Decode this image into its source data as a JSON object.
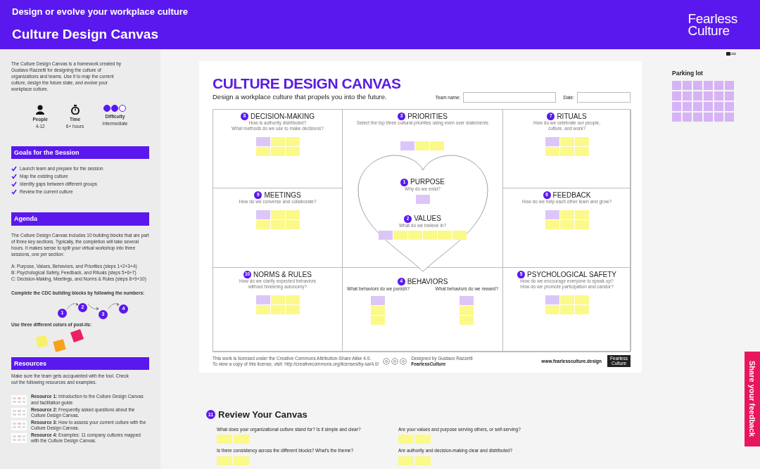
{
  "header": {
    "subtitle": "Design or evolve your workplace culture",
    "title": "Culture Design Canvas",
    "logo_lines": [
      "Fearless",
      "Culture"
    ]
  },
  "sidebar": {
    "intro": "The Culture Design Canvas is a framework created by Gustavo Razzetti for designing the culture of organizations and teams. Use it to map the current culture, design the future state, and evolve your workplace culture.",
    "stats": [
      {
        "kind": "people",
        "label": "People",
        "value": "4-12"
      },
      {
        "kind": "time",
        "label": "Time",
        "value": "6+ hours"
      },
      {
        "kind": "difficulty",
        "label": "Difficulty",
        "value": "Intermediate",
        "stars": 2
      }
    ],
    "goals": {
      "heading": "Goals for the Session",
      "items": [
        "Launch team and prepare for the session",
        "Map the existing culture",
        "Identify gaps between different groups",
        "Review the current culture"
      ]
    },
    "agenda": {
      "heading": "Agenda",
      "paragraph": "The Culture Design Canvas includes 10 building blocks that are part of three key sections. Typically, the completion will take several hours. It makes sense to split your virtual workshop into three sessions, one per section:",
      "sections": [
        "A: Purpose, Values, Behaviors, and Priorities (steps 1+2+3+4)",
        "B: Psychological Safety, Feedback, and Rituals (steps 5+6+7)",
        "C: Decision-Making, Meetings, and Norms & Rules (steps 8+9+10)"
      ],
      "steps_caption": "Complete the CDC building blocks by following the numbers:",
      "steps": [
        "1",
        "2",
        "3",
        "4"
      ],
      "postits_caption": "Use three different colors of post-its:",
      "postits": [
        {
          "color": "#f8f06a"
        },
        {
          "color": "#f7a21b"
        },
        {
          "color": "#ec1f5f"
        }
      ]
    },
    "resources": {
      "heading": "Resources",
      "intro": "Make sure the team gets accquainted with the tool. Check out the following resources and examples.",
      "items": [
        "**Resource 1:** Introduction to the Culture Design Canvas and facilitation guide",
        "**Resource 2:** Frequently asked questions about the Culture Design Canvas.",
        "**Resource 3:** How to assess your current culture with the Culture Design Canvas.",
        "**Resource 4:** Examples: 11 company cultures mapped with the Culture Design Canvas."
      ]
    }
  },
  "canvas": {
    "title": "CULTURE DESIGN CANVAS",
    "subtitle": "Design a workplace culture that propels you into the future.",
    "fields": [
      {
        "label": "Team name:"
      },
      {
        "label": "Date:"
      }
    ],
    "blocks": [
      {
        "kind": "grid",
        "number": "8",
        "title": "DECISION-MAKING",
        "questions": [
          "How is authority distributed?",
          "What methods do we use to make decisions?"
        ],
        "notes": [
          {
            "color": "#dcc6f8"
          },
          {
            "color": "#fbf98a"
          },
          {
            "color": "#fbf98a"
          },
          {
            "color": "#fbf98a"
          },
          {
            "color": "#fbf98a"
          },
          {
            "color": "#fbf98a"
          }
        ]
      },
      {
        "kind": "row",
        "number": "3",
        "title": "PRIORITIES",
        "questions": [
          "Select the top three cultural priorities using even over statements"
        ],
        "notes": [
          {
            "color": "#dcc6f8"
          },
          {
            "color": "#fbf98a"
          },
          {
            "color": "#fbf98a"
          }
        ]
      },
      {
        "kind": "grid",
        "number": "7",
        "title": "RITUALS",
        "questions": [
          "How do we celebrate our people, culture, and work?"
        ],
        "notes": [
          {
            "color": "#dcc6f8"
          },
          {
            "color": "#fbf98a"
          },
          {
            "color": "#fbf98a"
          },
          {
            "color": "#fbf98a"
          },
          {
            "color": "#fbf98a"
          },
          {
            "color": "#fbf98a"
          }
        ]
      },
      {
        "kind": "row",
        "number": "1",
        "title": "PURPOSE",
        "questions": [
          "Why do we exist?"
        ],
        "notes": [
          {
            "color": "#dcc6f8"
          }
        ]
      },
      {
        "kind": "grid",
        "number": "9",
        "title": "MEETINGS",
        "questions": [
          "How do we converse and collaborate?"
        ],
        "notes": [
          {
            "color": "#dcc6f8"
          },
          {
            "color": "#fbf98a"
          },
          {
            "color": "#fbf98a"
          },
          {
            "color": "#fbf98a"
          },
          {
            "color": "#fbf98a"
          },
          {
            "color": "#fbf98a"
          }
        ]
      },
      {
        "kind": "grid",
        "number": "6",
        "title": "FEEDBACK",
        "questions": [
          "How do we help each other learn and grow?"
        ],
        "notes": [
          {
            "color": "#dcc6f8"
          },
          {
            "color": "#fbf98a"
          },
          {
            "color": "#fbf98a"
          },
          {
            "color": "#fbf98a"
          },
          {
            "color": "#fbf98a"
          },
          {
            "color": "#fbf98a"
          }
        ]
      },
      {
        "kind": "row",
        "number": "2",
        "title": "VALUES",
        "questions": [
          "What do we believe in?"
        ],
        "notes": [
          {
            "color": "#dcc6f8"
          },
          {
            "color": "#fbf98a"
          },
          {
            "color": "#fbf98a"
          },
          {
            "color": "#fbf98a"
          },
          {
            "color": "#fbf98a"
          },
          {
            "color": "#fbf98a"
          }
        ]
      },
      {
        "kind": "grid",
        "number": "10",
        "title": "NORMS & RULES",
        "questions": [
          "How do we clarify expected behaviors",
          "without hindering autonomy?"
        ],
        "notes": [
          {
            "color": "#dcc6f8"
          },
          {
            "color": "#fbf98a"
          },
          {
            "color": "#fbf98a"
          },
          {
            "color": "#fbf98a"
          },
          {
            "color": "#fbf98a"
          },
          {
            "color": "#fbf98a"
          }
        ]
      },
      {
        "kind": "split",
        "number": "4",
        "title": "BEHAVIORS",
        "columns": [
          {
            "question": "What behaviors do we punish?",
            "notes": [
              {
                "color": "#dcc6f8"
              },
              {
                "color": "#fbf98a"
              },
              {
                "color": "#fbf98a"
              }
            ]
          },
          {
            "question": "What behaviors do we reward?",
            "notes": [
              {
                "color": "#dcc6f8"
              },
              {
                "color": "#fbf98a"
              },
              {
                "color": "#fbf98a"
              }
            ]
          }
        ]
      },
      {
        "kind": "grid",
        "number": "5",
        "title": "PSYCHOLOGICAL SAFETY",
        "questions": [
          "How do we encourage everyone to speak up?",
          "How do we promote participation and candor?"
        ],
        "notes": [
          {
            "color": "#dcc6f8"
          },
          {
            "color": "#fbf98a"
          },
          {
            "color": "#fbf98a"
          },
          {
            "color": "#fbf98a"
          },
          {
            "color": "#fbf98a"
          },
          {
            "color": "#fbf98a"
          }
        ]
      }
    ],
    "footer": {
      "license": [
        "This work is licensed under the Creative Commons Attribution-Share Alike 4.0.",
        "To view a copy of this license, visit: http://creativecommons.org/licenses/by-sa/4.0/"
      ],
      "designer": "Designed by Gustavo Razzetti",
      "brand": "FearlessCulture",
      "url": "www.fearlessculture.design",
      "logo_lines": [
        "Fearless",
        "Culture"
      ]
    }
  },
  "parking_lot": {
    "title": "Parking lot",
    "notes": [
      {
        "color": "#d7b3f5"
      },
      {
        "color": "#d7b3f5"
      },
      {
        "color": "#d7b3f5"
      },
      {
        "color": "#d7b3f5"
      },
      {
        "color": "#d7b3f5"
      },
      {
        "color": "#d7b3f5"
      },
      {
        "color": "#d7b3f5"
      },
      {
        "color": "#d7b3f5"
      },
      {
        "color": "#d7b3f5"
      },
      {
        "color": "#d7b3f5"
      },
      {
        "color": "#d7b3f5"
      },
      {
        "color": "#d7b3f5"
      },
      {
        "color": "#d7b3f5"
      },
      {
        "color": "#d7b3f5"
      },
      {
        "color": "#d7b3f5"
      },
      {
        "color": "#d7b3f5"
      },
      {
        "color": "#d7b3f5"
      },
      {
        "color": "#d7b3f5"
      },
      {
        "color": "#d7b3f5"
      },
      {
        "color": "#d7b3f5"
      },
      {
        "color": "#d7b3f5"
      },
      {
        "color": "#d7b3f5"
      },
      {
        "color": "#d7b3f5"
      },
      {
        "color": "#d7b3f5"
      }
    ]
  },
  "review": {
    "number": "11",
    "title": "Review Your Canvas",
    "questions": [
      {
        "text": "What does your organizational culture stand for? Is it simple and clear?",
        "notes": [
          {
            "color": "#fbf98a"
          },
          {
            "color": "#fbf98a"
          }
        ]
      },
      {
        "text": "Are your values and purpose serving others, or self-serving?",
        "notes": [
          {
            "color": "#fbf98a"
          },
          {
            "color": "#fbf98a"
          }
        ]
      },
      {
        "text": "Is there consistency across the different blocks? What's the theme?",
        "notes": [
          {
            "color": "#fbf98a"
          },
          {
            "color": "#fbf98a"
          }
        ]
      },
      {
        "text": "Are authority and decision-making clear and distributed?",
        "notes": [
          {
            "color": "#fbf98a"
          },
          {
            "color": "#fbf98a"
          }
        ]
      }
    ]
  },
  "feedback_tab": {
    "label": "Share your feedback"
  }
}
